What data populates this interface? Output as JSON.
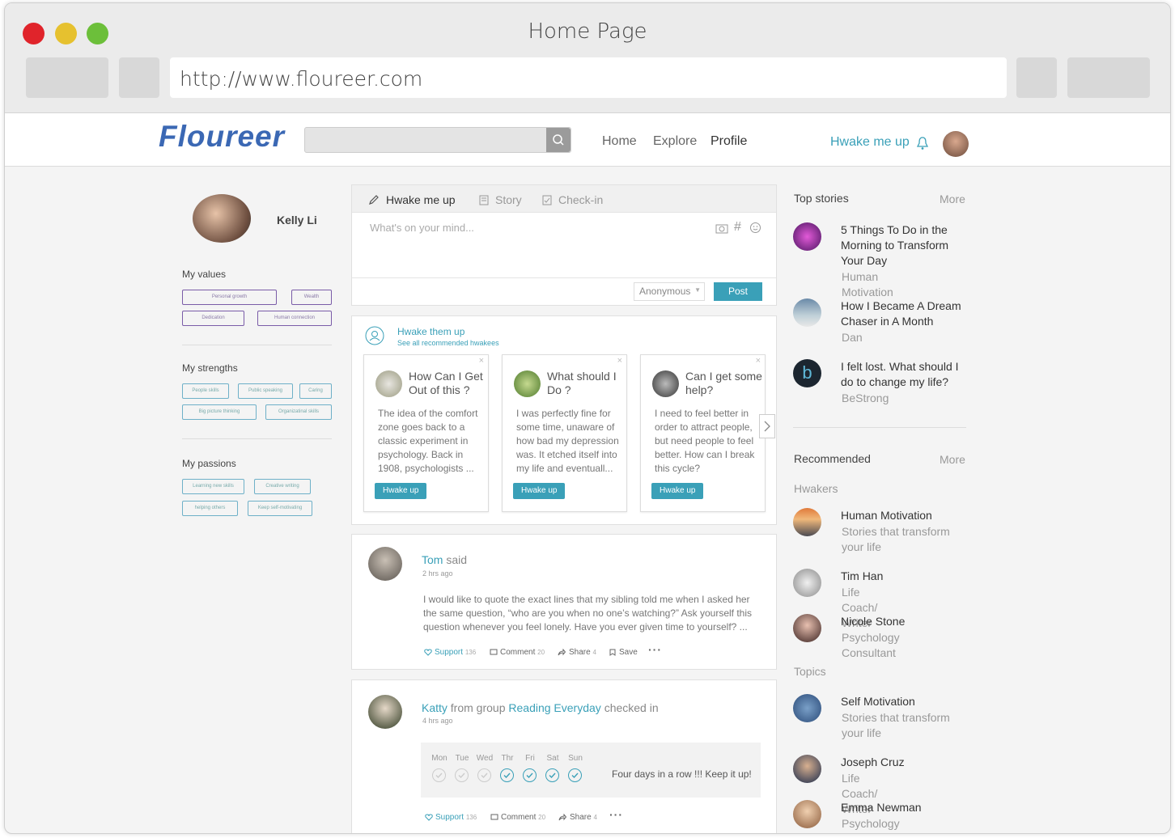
{
  "window": {
    "title": "Home Page",
    "url": "http://www.floureer.com"
  },
  "colors": {
    "accent": "#3aa0b8",
    "brand": "#3b68b4",
    "tag_values": "#7a5ca8",
    "traffic_red": "#e0242b",
    "traffic_yellow": "#e6c12f",
    "traffic_green": "#6cbf3a"
  },
  "nav": {
    "logo": "Floureer",
    "links": [
      "Home",
      "Explore",
      "Profile"
    ],
    "hwake": "Hwake me up"
  },
  "profile": {
    "name": "Kelly Li",
    "values_title": "My values",
    "values": [
      "Personal growth",
      "Wealth",
      "Dedication",
      "Human connection"
    ],
    "strengths_title": "My strengths",
    "strengths": [
      "People skills",
      "Public speaking",
      "Caring",
      "Big picture thinking",
      "Organizatinal skills"
    ],
    "passions_title": "My passions",
    "passions": [
      "Learning new skills",
      "Creative writing",
      "helping others",
      "Keep self-motivating"
    ]
  },
  "composer": {
    "tabs": [
      "Hwake me up",
      "Story",
      "Check-in"
    ],
    "placeholder": "What's on your mind...",
    "visibility": "Anonymous",
    "post": "Post"
  },
  "recommend": {
    "title": "Hwake them up",
    "link": "See all recommended hwakees",
    "button": "Hwake up",
    "cards": [
      {
        "title": "How Can I Get Out of this ?",
        "text": "The idea of the comfort zone goes back to a classic experiment in psychology. Back in 1908, psychologists ..."
      },
      {
        "title": "What should I Do ?",
        "text": "I was perfectly fine for some time, unaware of how bad my depression was. It etched itself into my life and eventuall..."
      },
      {
        "title": "Can I get some help?",
        "text": "I need to feel better in order to attract people, but need people to feel better. How can I break this cycle?"
      }
    ]
  },
  "post1": {
    "user": "Tom",
    "said": "said",
    "time": "2 hrs ago",
    "text": "I would like to quote the exact lines that my sibling told me when I asked her the same question, “who are you when no one’s watching?” Ask yourself this question whenever you feel lonely. Have you ever given time to yourself? ...",
    "support": "Support",
    "support_count": "136",
    "comment": "Comment",
    "comment_count": "20",
    "share": "Share",
    "share_count": "4",
    "save": "Save"
  },
  "post2": {
    "user": "Katty",
    "from": "from group",
    "group": "Reading Everyday",
    "action": "checked in",
    "time": "4 hrs ago",
    "days": [
      "Mon",
      "Tue",
      "Wed",
      "Thr",
      "Fri",
      "Sat",
      "Sun"
    ],
    "checked": [
      false,
      false,
      false,
      true,
      true,
      true,
      true
    ],
    "message": "Four days in a row !!! Keep it up!",
    "support": "Support",
    "support_count": "136",
    "comment": "Comment",
    "comment_count": "20",
    "share": "Share",
    "share_count": "4"
  },
  "top_stories": {
    "title": "Top stories",
    "more": "More",
    "items": [
      {
        "title": "5 Things To Do in the Morning to Transform Your Day",
        "source": "Human Motivation"
      },
      {
        "title": "How I Became A Dream Chaser in A Month",
        "source": "Dan"
      },
      {
        "title": "I felt lost. What should I do to change my life?",
        "source": "BeStrong"
      }
    ]
  },
  "recommended": {
    "title": "Recommended",
    "more": "More",
    "hwakers_title": "Hwakers",
    "hwakers": [
      {
        "name": "Human Motivation",
        "desc": "Stories that transform your life"
      },
      {
        "name": "Tim Han",
        "desc": "Life Coach/ Writer"
      },
      {
        "name": "Nicole Stone",
        "desc": "Psychology Consultant"
      }
    ],
    "topics_title": "Topics",
    "topics": [
      {
        "name": "Self Motivation",
        "desc": "Stories that transform your life"
      },
      {
        "name": "Joseph Cruz",
        "desc": "Life Coach/ Writer"
      },
      {
        "name": "Emma Newman",
        "desc": "Psychology Consultant"
      }
    ]
  }
}
